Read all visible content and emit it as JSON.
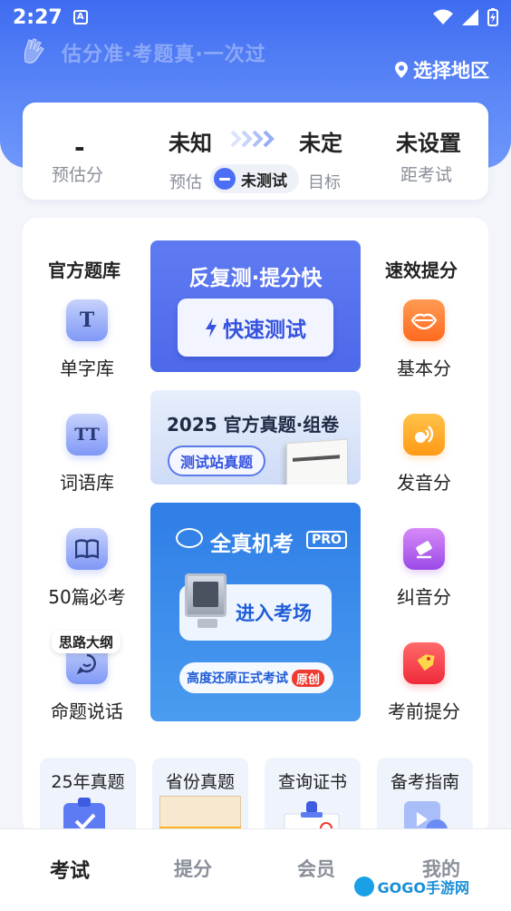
{
  "status_bar": {
    "time": "2:27",
    "notif_letter": "A"
  },
  "header": {
    "slogan": "估分准·考题真·一次过",
    "region_button": "选择地区"
  },
  "score_card": {
    "estimated_score_value": "-",
    "estimated_score_label": "预估分",
    "current_level": "未知",
    "target_level": "未定",
    "estimate_label": "预估",
    "untested_pill": "未测试",
    "target_label": "目标",
    "exam_countdown_value": "未设置",
    "exam_countdown_label": "距考试"
  },
  "left_column": {
    "title": "官方题库",
    "items": [
      {
        "label": "单字库",
        "icon": "T"
      },
      {
        "label": "词语库",
        "icon": "TT"
      },
      {
        "label": "50篇必考",
        "icon": "book"
      },
      {
        "label": "命题说话",
        "icon": "chat",
        "tag": "思路大纲"
      }
    ]
  },
  "right_column": {
    "title": "速效提分",
    "items": [
      {
        "label": "基本分",
        "icon": "lips"
      },
      {
        "label": "发音分",
        "icon": "voice"
      },
      {
        "label": "纠音分",
        "icon": "eraser"
      },
      {
        "label": "考前提分",
        "icon": "tag"
      }
    ]
  },
  "banners": {
    "quick_test": {
      "title": "反复测·提分快",
      "button": "快速测试"
    },
    "official_exam": {
      "title": "2025 官方真题·组卷",
      "button": "测试站真题"
    },
    "mock_exam": {
      "title": "全真机考",
      "pro_badge": "PRO",
      "button": "进入考场",
      "subtitle": "高度还原正式考试",
      "original_tag": "原创"
    }
  },
  "quick_cards": [
    {
      "label": "25年真题"
    },
    {
      "label": "省份真题"
    },
    {
      "label": "查询证书"
    },
    {
      "label": "备考指南"
    }
  ],
  "bottom_nav": {
    "items": [
      {
        "label": "考试",
        "active": true
      },
      {
        "label": "提分",
        "active": false
      },
      {
        "label": "会员",
        "active": false
      },
      {
        "label": "我的",
        "active": false
      }
    ]
  },
  "watermark": "GOGO手游网",
  "colors": {
    "primary": "#4b6ef5",
    "header_gradient_top": "#3f6cf1",
    "mock_exam_blue": "#2f7de6"
  }
}
